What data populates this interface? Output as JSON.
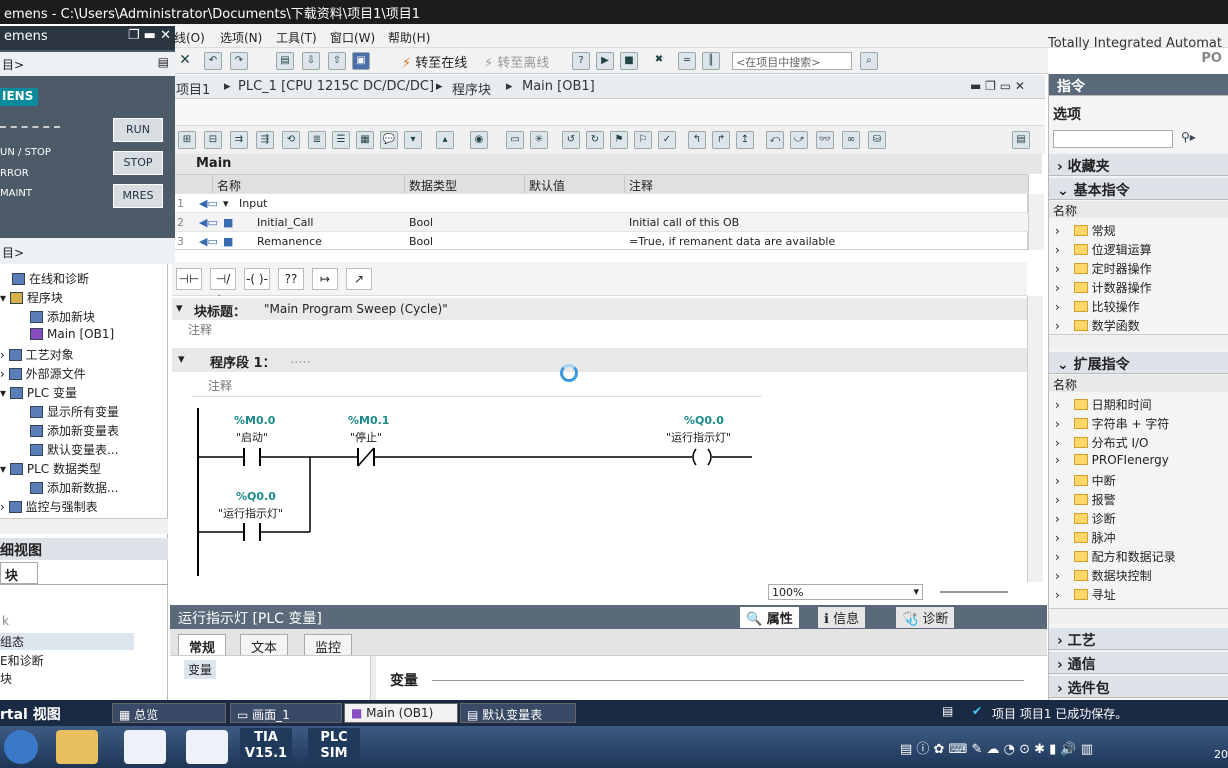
{
  "titlebar": {
    "text": "emens  -  C:\\Users\\Administrator\\Documents\\下载资料\\项目1\\项目1"
  },
  "menu": [
    "线(O)",
    "选项(N)",
    "工具(T)",
    "窗口(W)",
    "帮助(H)"
  ],
  "toolbar": {
    "go_online": "转至在线",
    "go_offline": "转至离线",
    "search_placeholder": "<在项目中搜索>"
  },
  "brand": {
    "line1": "Totally Integrated Automat",
    "line2": "PO"
  },
  "breadcrumb": [
    "项目1",
    "PLC_1 [CPU 1215C DC/DC/DC]",
    "程序块",
    "Main [OB1]"
  ],
  "block_header": "Main",
  "interface_table": {
    "columns": [
      "名称",
      "数据类型",
      "默认值",
      "注释"
    ],
    "rows": [
      {
        "num": "1",
        "name": "Input",
        "type": "",
        "default": "",
        "comment": ""
      },
      {
        "num": "2",
        "name": "Initial_Call",
        "type": "Bool",
        "default": "",
        "comment": "Initial call of this OB"
      },
      {
        "num": "3",
        "name": "Remanence",
        "type": "Bool",
        "default": "",
        "comment": "=True, if remanent data are available"
      }
    ]
  },
  "block_title": {
    "label": "块标题：",
    "value": "\"Main Program Sweep (Cycle)\"",
    "comment": "注释"
  },
  "network": {
    "label": "程序段 1：",
    "dots": ".....",
    "comment": "注释"
  },
  "ladder": {
    "contact1": {
      "addr": "%M0.0",
      "name": "\"启动\""
    },
    "contact2": {
      "addr": "%M0.1",
      "name": "\"停止\""
    },
    "coil": {
      "addr": "%Q0.0",
      "name": "\"运行指示灯\""
    },
    "contact3": {
      "addr": "%Q0.0",
      "name": "\"运行指示灯\""
    }
  },
  "zoom": "100%",
  "inspector": {
    "title": "运行指示灯 [PLC 变量]",
    "right_tabs": [
      "属性",
      "信息",
      "诊断"
    ],
    "tabs": [
      "常规",
      "文本",
      "监控"
    ],
    "left_item": "变量",
    "section": "变量"
  },
  "right_panel": {
    "title": "指令",
    "options": "选项",
    "favorites": "收藏夹",
    "basic": "基本指令",
    "name_col": "名称",
    "basic_items": [
      "常规",
      "位逻辑运算",
      "定时器操作",
      "计数器操作",
      "比较操作",
      "数学函数"
    ],
    "extended": "扩展指令",
    "extended_items": [
      "日期和时间",
      "字符串 + 字符",
      "分布式 I/O",
      "PROFIenergy",
      "中断",
      "报警",
      "诊断",
      "脉冲",
      "配方和数据记录",
      "数据块控制",
      "寻址"
    ],
    "tech": "工艺",
    "comm": "通信",
    "optional": "选件包"
  },
  "plcsim": {
    "title": "emens",
    "line1": "目>",
    "brand": "IENS",
    "run": "RUN",
    "stop": "STOP",
    "mres": "MRES",
    "lbl_runstop": "UN / STOP",
    "lbl_error": "RROR",
    "lbl_maint": "MAINT",
    "line2": "目>"
  },
  "project_tree": {
    "items": [
      {
        "label": "在线和诊断",
        "indent": 1
      },
      {
        "label": "程序块",
        "indent": 0
      },
      {
        "label": "添加新块",
        "indent": 2
      },
      {
        "label": "Main [OB1]",
        "indent": 2
      },
      {
        "label": "工艺对象",
        "indent": 0
      },
      {
        "label": "外部源文件",
        "indent": 0
      },
      {
        "label": "PLC 变量",
        "indent": 0
      },
      {
        "label": "显示所有变量",
        "indent": 2
      },
      {
        "label": "添加新变量表",
        "indent": 2
      },
      {
        "label": "默认变量表...",
        "indent": 2
      },
      {
        "label": "PLC 数据类型",
        "indent": 0
      },
      {
        "label": "添加新数据...",
        "indent": 2
      },
      {
        "label": "监控与强制表",
        "indent": 0
      }
    ],
    "details_title": "细视图",
    "details_tab": "块",
    "details_rows": [
      "k",
      "组态",
      "E和诊断",
      "块"
    ]
  },
  "portal_bar": {
    "portal_view": "rtal 视图",
    "tabs": [
      "总览",
      "画面_1",
      "Main (OB1)",
      "默认变量表"
    ],
    "status": "项目 项目1 已成功保存。"
  },
  "taskbar": {
    "tia": "TIA V15.1",
    "plcsim": "PLC SIM",
    "clock": "20"
  }
}
